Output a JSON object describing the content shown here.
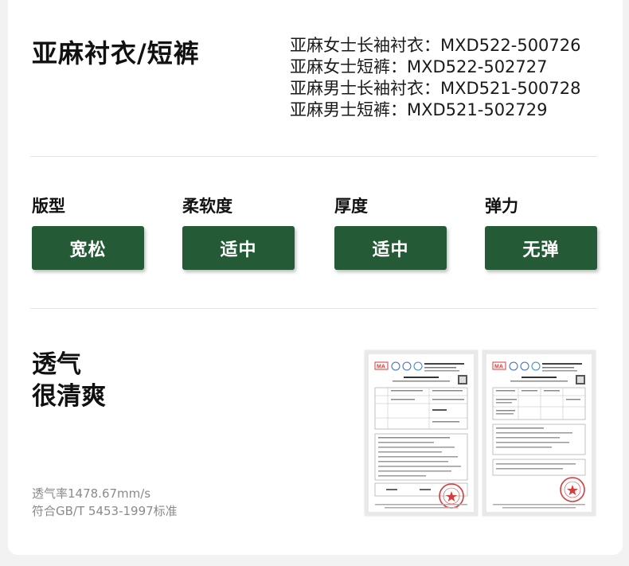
{
  "product": {
    "title": "亚麻衬衣/短裤",
    "codes": [
      "亚麻女士长袖衬衣：MXD522-500726",
      "亚麻女士短裤：MXD522-502727",
      "亚麻男士长袖衬衣：MXD521-500728",
      "亚麻男士短裤：MXD521-502729"
    ]
  },
  "attributes": [
    {
      "label": "版型",
      "value": "宽松"
    },
    {
      "label": "柔软度",
      "value": "适中"
    },
    {
      "label": "厚度",
      "value": "适中"
    },
    {
      "label": "弹力",
      "value": "无弹"
    }
  ],
  "feature": {
    "line1": "透气",
    "line2": "很清爽",
    "spec_line1": "透气率1478.67mm/s",
    "spec_line2": "符合GB/T 5453-1997标准"
  },
  "reports": [
    {
      "name": "test-report-1",
      "logo_text": "MA"
    },
    {
      "name": "test-report-2",
      "logo_text": "MA"
    }
  ],
  "colors": {
    "badge": "#255a37",
    "stamp": "#d83a3a",
    "spec_text": "#8a8a8a"
  },
  "icons": [
    "test-report-thumbnail-icon",
    "inspection-seal-icon"
  ]
}
